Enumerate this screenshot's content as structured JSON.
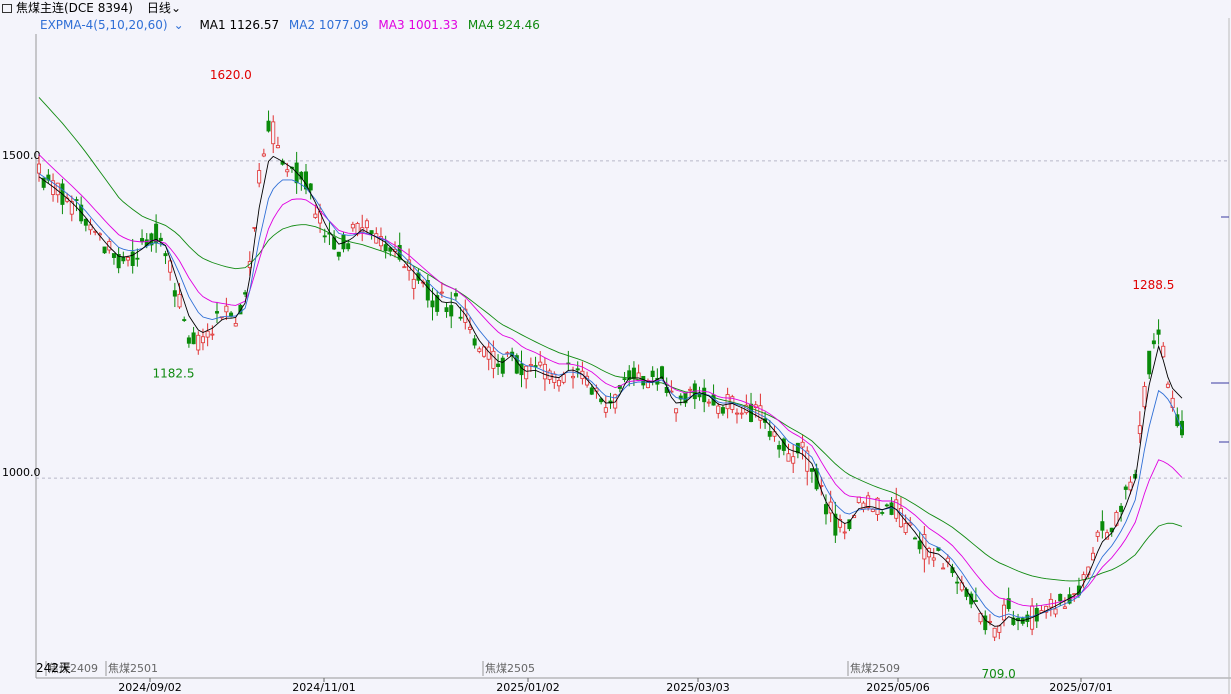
{
  "window": {
    "title": "焦煤主连(DCE 8394)",
    "period": "日线"
  },
  "legend": {
    "indicator": "EXPMA-4(5,10,20,60)",
    "ma1": {
      "label": "MA1 1126.57",
      "color": "#000000"
    },
    "ma2": {
      "label": "MA2 1077.09",
      "color": "#2f6fd6"
    },
    "ma3": {
      "label": "MA3 1001.33",
      "color": "#e000e0"
    },
    "ma4": {
      "label": "MA4 924.46",
      "color": "#108a10"
    }
  },
  "colors": {
    "up": "#e03030",
    "down": "#0a8a0a"
  },
  "status": {
    "days": "242天"
  },
  "contracts": [
    "焦煤2409",
    "焦煤2501",
    "焦煤2505",
    "焦煤2509"
  ],
  "chart_data": {
    "type": "candlestick",
    "x_ticks": [
      "2024/09/02",
      "2024/11/01",
      "2025/01/02",
      "2025/03/03",
      "2025/05/06",
      "2025/07/01"
    ],
    "y_ticks": [
      "1500.0",
      "1000.0"
    ],
    "ylim": [
      685,
      1700
    ],
    "grid": "horizontal dashed",
    "annotations": [
      {
        "label": "1620.0",
        "value": 1620.0,
        "kind": "high"
      },
      {
        "label": "1182.5",
        "value": 1182.5,
        "kind": "low"
      },
      {
        "label": "709.0",
        "value": 709.0,
        "kind": "low"
      },
      {
        "label": "1288.5",
        "value": 1288.5,
        "kind": "high"
      }
    ],
    "close_path": [
      1480,
      1460,
      1450,
      1430,
      1410,
      1380,
      1360,
      1340,
      1350,
      1370,
      1390,
      1360,
      1290,
      1230,
      1210,
      1240,
      1260,
      1250,
      1290,
      1470,
      1560,
      1500,
      1490,
      1470,
      1430,
      1380,
      1360,
      1380,
      1400,
      1380,
      1370,
      1350,
      1330,
      1310,
      1290,
      1270,
      1280,
      1250,
      1210,
      1190,
      1170,
      1200,
      1160,
      1170,
      1160,
      1155,
      1180,
      1165,
      1140,
      1110,
      1120,
      1170,
      1160,
      1150,
      1165,
      1110,
      1120,
      1140,
      1130,
      1110,
      1120,
      1110,
      1100,
      1090,
      1065,
      1040,
      1040,
      1020,
      960,
      930,
      920,
      960,
      960,
      950,
      960,
      930,
      910,
      880,
      880,
      860,
      830,
      800,
      770,
      760,
      790,
      770,
      780,
      790,
      800,
      810,
      820,
      860,
      910,
      920,
      960,
      1010,
      1170,
      1250,
      1120,
      1080
    ],
    "ma1": [
      1475,
      1462,
      1448,
      1432,
      1412,
      1388,
      1366,
      1348,
      1350,
      1362,
      1378,
      1366,
      1310,
      1255,
      1228,
      1236,
      1252,
      1252,
      1280,
      1420,
      1510,
      1500,
      1488,
      1468,
      1432,
      1392,
      1368,
      1376,
      1392,
      1382,
      1372,
      1354,
      1334,
      1314,
      1294,
      1276,
      1278,
      1256,
      1220,
      1198,
      1180,
      1194,
      1168,
      1170,
      1162,
      1158,
      1172,
      1165,
      1144,
      1118,
      1120,
      1158,
      1158,
      1150,
      1160,
      1118,
      1120,
      1136,
      1130,
      1114,
      1118,
      1110,
      1100,
      1090,
      1068,
      1044,
      1040,
      1022,
      968,
      938,
      926,
      952,
      956,
      950,
      956,
      934,
      912,
      884,
      880,
      862,
      834,
      804,
      775,
      764,
      782,
      774,
      780,
      789,
      798,
      808,
      818,
      852,
      898,
      915,
      950,
      1000,
      1135,
      1210,
      1145,
      1126
    ],
    "ma2": [
      1480,
      1468,
      1455,
      1440,
      1422,
      1400,
      1380,
      1362,
      1358,
      1362,
      1372,
      1366,
      1330,
      1285,
      1255,
      1250,
      1255,
      1255,
      1270,
      1370,
      1450,
      1470,
      1470,
      1460,
      1438,
      1408,
      1385,
      1382,
      1388,
      1382,
      1375,
      1360,
      1342,
      1322,
      1303,
      1286,
      1282,
      1264,
      1236,
      1214,
      1195,
      1196,
      1178,
      1175,
      1167,
      1162,
      1168,
      1164,
      1150,
      1130,
      1126,
      1148,
      1152,
      1150,
      1155,
      1128,
      1124,
      1134,
      1131,
      1118,
      1119,
      1113,
      1104,
      1095,
      1078,
      1056,
      1048,
      1032,
      990,
      958,
      942,
      950,
      952,
      950,
      954,
      940,
      922,
      898,
      890,
      874,
      850,
      822,
      796,
      780,
      786,
      780,
      782,
      788,
      795,
      803,
      812,
      838,
      874,
      895,
      925,
      968,
      1070,
      1140,
      1120,
      1077
    ],
    "ma3": [
      1510,
      1492,
      1475,
      1458,
      1440,
      1420,
      1400,
      1382,
      1374,
      1372,
      1375,
      1370,
      1348,
      1315,
      1288,
      1278,
      1275,
      1272,
      1280,
      1340,
      1400,
      1430,
      1440,
      1440,
      1428,
      1408,
      1390,
      1385,
      1386,
      1382,
      1376,
      1365,
      1352,
      1336,
      1320,
      1305,
      1298,
      1284,
      1264,
      1244,
      1226,
      1220,
      1205,
      1198,
      1188,
      1180,
      1180,
      1176,
      1166,
      1150,
      1142,
      1152,
      1154,
      1153,
      1155,
      1140,
      1134,
      1138,
      1136,
      1127,
      1126,
      1121,
      1113,
      1105,
      1092,
      1074,
      1064,
      1050,
      1018,
      990,
      972,
      970,
      968,
      964,
      964,
      954,
      940,
      922,
      910,
      896,
      876,
      852,
      830,
      812,
      808,
      800,
      798,
      800,
      803,
      808,
      814,
      832,
      858,
      876,
      900,
      932,
      990,
      1030,
      1020,
      1001
    ],
    "ma4": [
      1600,
      1580,
      1560,
      1538,
      1515,
      1490,
      1465,
      1440,
      1425,
      1412,
      1405,
      1398,
      1385,
      1365,
      1348,
      1340,
      1334,
      1330,
      1332,
      1352,
      1378,
      1392,
      1398,
      1400,
      1396,
      1388,
      1378,
      1372,
      1368,
      1362,
      1356,
      1348,
      1339,
      1329,
      1318,
      1306,
      1298,
      1286,
      1272,
      1258,
      1243,
      1234,
      1224,
      1215,
      1206,
      1198,
      1192,
      1186,
      1178,
      1168,
      1160,
      1158,
      1155,
      1152,
      1150,
      1142,
      1136,
      1134,
      1130,
      1124,
      1120,
      1115,
      1108,
      1101,
      1092,
      1080,
      1070,
      1058,
      1040,
      1022,
      1007,
      998,
      990,
      983,
      977,
      968,
      957,
      945,
      935,
      924,
      910,
      895,
      880,
      868,
      860,
      852,
      846,
      842,
      840,
      838,
      838,
      842,
      850,
      856,
      866,
      880,
      905,
      925,
      930,
      924
    ]
  }
}
